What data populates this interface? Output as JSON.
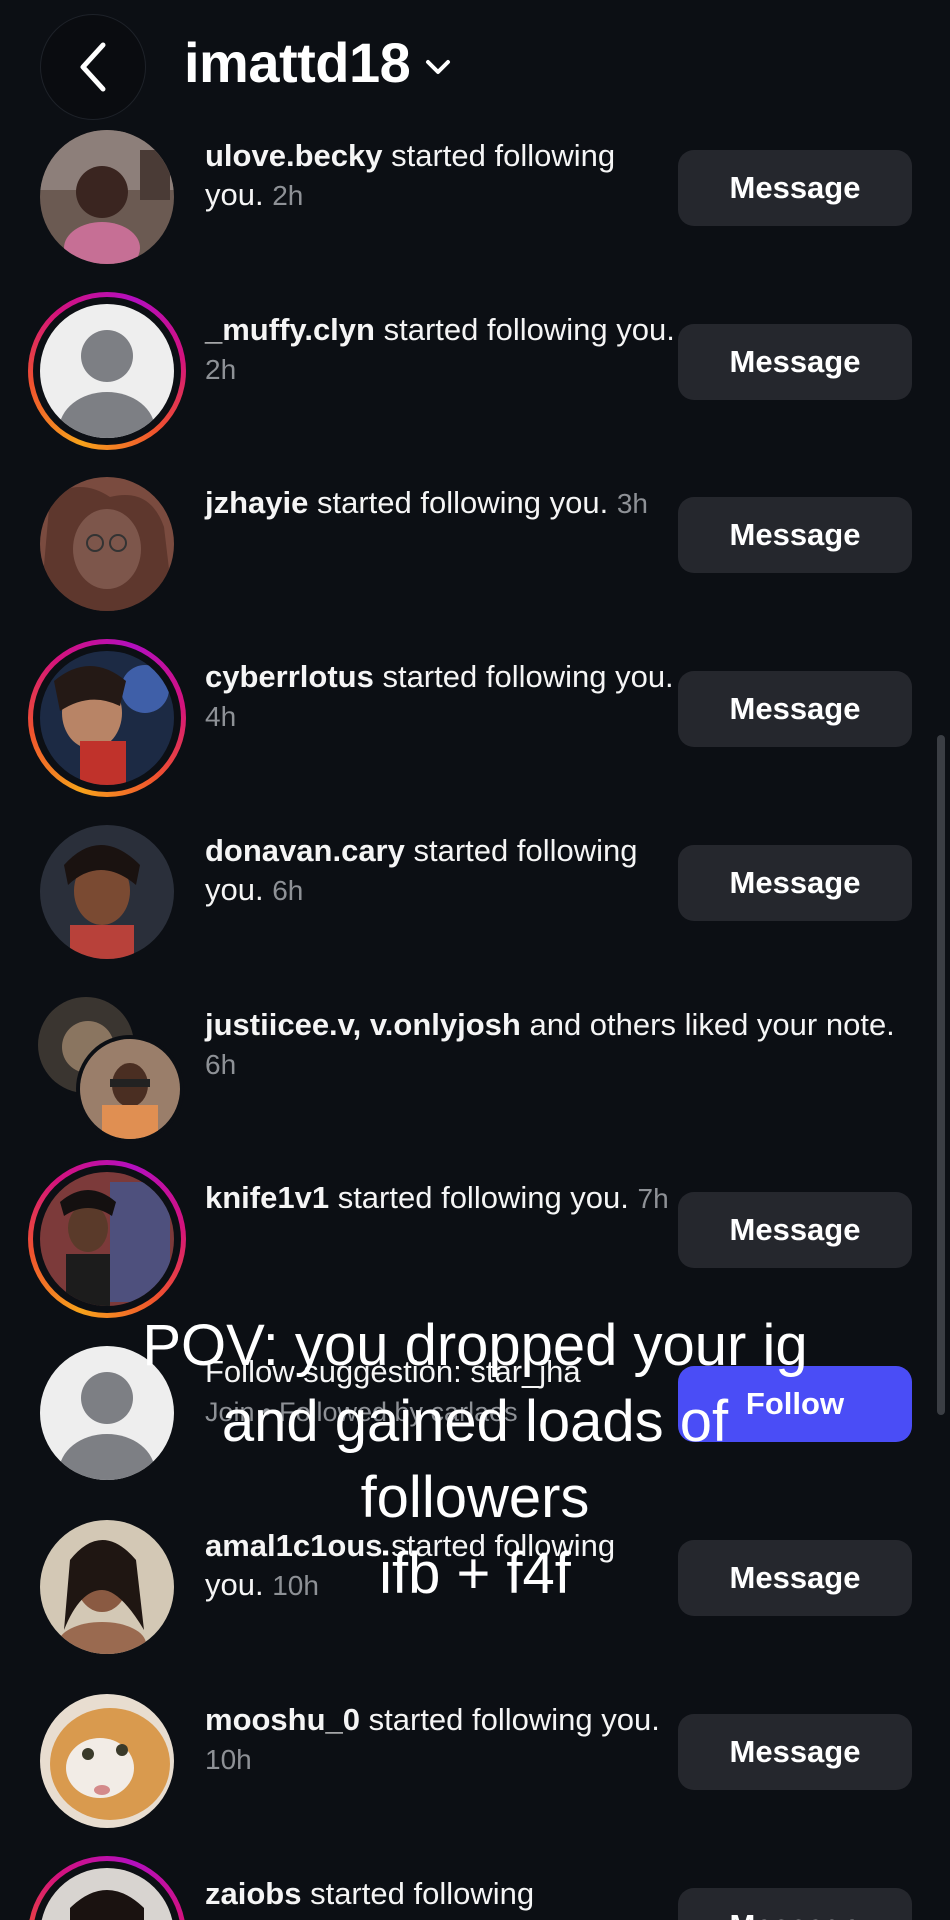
{
  "header": {
    "title": "imattd18",
    "back_icon": "chevron-left-icon",
    "dropdown_icon": "chevron-down-icon"
  },
  "notifications": [
    {
      "user": "ulove.becky",
      "text": " started following you.",
      "time": "2h",
      "button": "Message",
      "ring": false
    },
    {
      "user": "_muffy.clyn",
      "text": " started following you.",
      "time": "2h",
      "button": "Message",
      "ring": true
    },
    {
      "user": "jzhayie",
      "text": " started following you.",
      "time": "3h",
      "button": "Message",
      "ring": false
    },
    {
      "user": "cyberrlotus",
      "text": " started following you.",
      "time": "4h",
      "button": "Message",
      "ring": true
    },
    {
      "user": "donavan.cary",
      "text": " started following you.",
      "time": "6h",
      "button": "Message",
      "ring": false
    },
    {
      "user": "justiicee.v, v.onlyjosh",
      "text": " and others liked your note.",
      "time": "6h",
      "button": "",
      "ring": false
    },
    {
      "user": "knife1v1",
      "text": " started following you.",
      "time": "7h",
      "button": "Message",
      "ring": true
    },
    {
      "user": "",
      "text": "Follow suggestion: star_jha",
      "time": "",
      "sub": "Join • Followed by carlaes",
      "button": "Follow",
      "ring": false
    },
    {
      "user": "amal1c1ous",
      "text": " started following you.",
      "time": "10h",
      "button": "Message",
      "ring": false
    },
    {
      "user": "mooshu_0",
      "text": " started following you.",
      "time": "10h",
      "button": "Message",
      "ring": false
    },
    {
      "user": "zaiobs",
      "text": " started following",
      "time": "",
      "button": "Message",
      "ring": true
    }
  ],
  "overlay": {
    "line1": "POV: you dropped your ig",
    "line2": "and gained loads of",
    "line3": "followers",
    "line4": "ifb + f4f"
  },
  "colors": {
    "background": "#0c0f14",
    "button": "#25272d",
    "follow": "#4a4df6",
    "muted": "#8e9196"
  }
}
